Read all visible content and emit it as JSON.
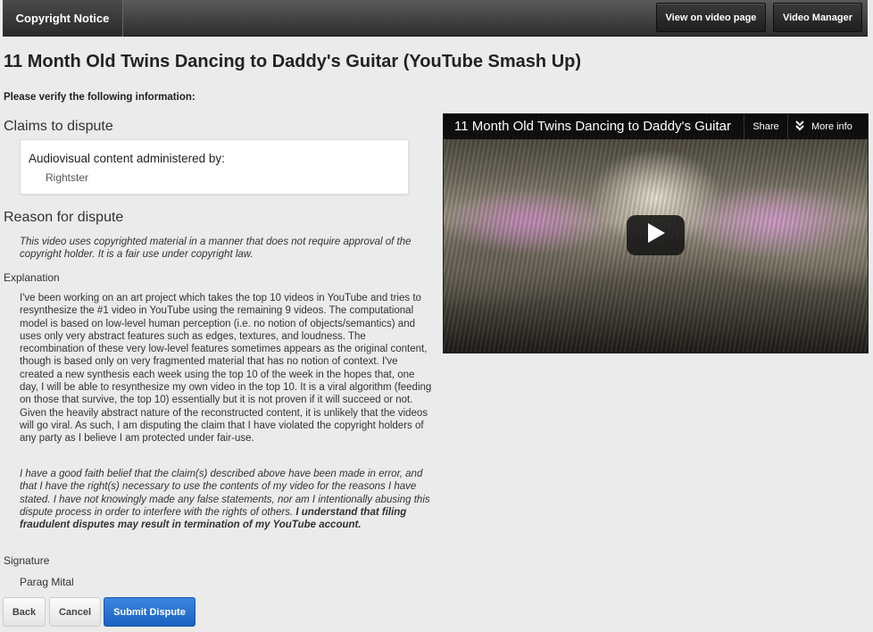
{
  "topbar": {
    "tab_label": "Copyright Notice",
    "view_on_video_page": "View on video page",
    "video_manager": "Video Manager"
  },
  "page_title": "11 Month Old Twins Dancing to Daddy's Guitar (YouTube Smash Up)",
  "verify_heading": "Please verify the following information:",
  "claims": {
    "heading": "Claims to dispute",
    "card_title": "Audiovisual content administered by:",
    "card_owner": "Rightster"
  },
  "reason": {
    "heading": "Reason for dispute",
    "text": "This video uses copyrighted material in a manner that does not require approval of the copyright holder. It is a fair use under copyright law."
  },
  "explanation": {
    "label": "Explanation",
    "text": "I've been working on an art project which takes the top 10 videos in YouTube and tries to resynthesize the #1 video in YouTube using the remaining 9 videos. The computational model is based on low-level human perception (i.e. no notion of objects/semantics) and uses only very abstract features such as edges, textures, and loudness. The recombination of these very low-level features sometimes appears as the original content, though is based only on very fragmented material that has no notion of context. I've created a new synthesis each week using the top 10 of the week in the hopes that, one day, I will be able to resynthesize my own video in the top 10. It is a viral algorithm (feeding on those that survive, the top 10) essentially but it is not proven if it will succeed or not. Given the heavily abstract nature of the reconstructed content, it is unlikely that the videos will go viral. As such, I am disputing the claim that I have violated the copyright holders of any party as I believe I am protected under fair-use."
  },
  "good_faith": {
    "text": "I have a good faith belief that the claim(s) described above have been made in error, and that I have the right(s) necessary to use the contents of my video for the reasons I have stated. I have not knowingly made any false statements, nor am I intentionally abusing this dispute process in order to interfere with the rights of others.",
    "bold_text": "I understand that filing fraudulent disputes may result in termination of my YouTube account."
  },
  "signature": {
    "label": "Signature",
    "name": "Parag Mital"
  },
  "buttons": {
    "back": "Back",
    "cancel": "Cancel",
    "submit": "Submit Dispute"
  },
  "player": {
    "title": "11 Month Old Twins Dancing to Daddy's Guitar",
    "share": "Share",
    "more_info": "More info"
  }
}
